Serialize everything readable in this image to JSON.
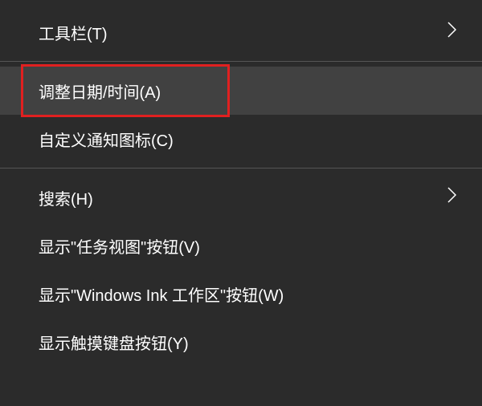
{
  "menu": {
    "items": [
      {
        "label": "工具栏(T)",
        "has_submenu": true
      },
      {
        "label": "调整日期/时间(A)",
        "has_submenu": false,
        "hovered": true,
        "highlighted": true
      },
      {
        "label": "自定义通知图标(C)",
        "has_submenu": false
      },
      {
        "label": "搜索(H)",
        "has_submenu": true
      },
      {
        "label": "显示\"任务视图\"按钮(V)",
        "has_submenu": false
      },
      {
        "label": "显示\"Windows Ink 工作区\"按钮(W)",
        "has_submenu": false
      },
      {
        "label": "显示触摸键盘按钮(Y)",
        "has_submenu": false
      }
    ]
  }
}
